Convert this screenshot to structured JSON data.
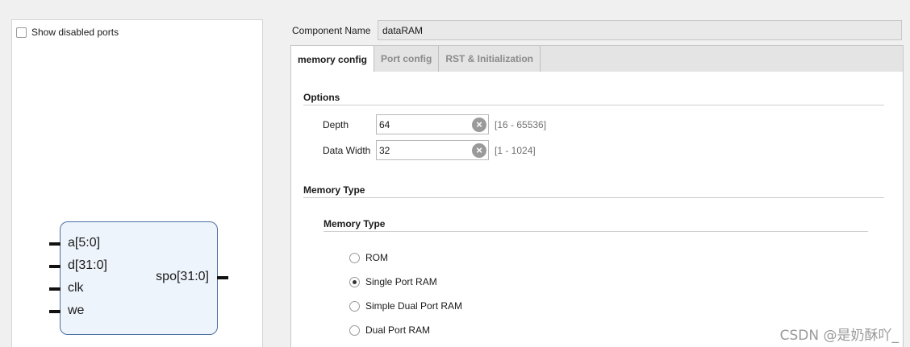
{
  "left_panel": {
    "show_disabled_label": "Show disabled ports",
    "symbol": {
      "inputs": [
        "a[5:0]",
        "d[31:0]",
        "clk",
        "we"
      ],
      "output": "spo[31:0]"
    }
  },
  "component": {
    "label": "Component Name",
    "value": "dataRAM"
  },
  "tabs": [
    {
      "label": "memory config",
      "active": true
    },
    {
      "label": "Port config",
      "active": false
    },
    {
      "label": "RST & Initialization",
      "active": false
    }
  ],
  "options": {
    "title": "Options",
    "depth_label": "Depth",
    "depth_value": "64",
    "depth_range": "[16 - 65536]",
    "width_label": "Data Width",
    "width_value": "32",
    "width_range": "[1 - 1024]"
  },
  "memory_type": {
    "section_title": "Memory Type",
    "group_title": "Memory Type",
    "options": [
      {
        "label": "ROM",
        "checked": false
      },
      {
        "label": "Single Port RAM",
        "checked": true
      },
      {
        "label": "Simple Dual Port RAM",
        "checked": false
      },
      {
        "label": "Dual Port RAM",
        "checked": false
      }
    ]
  },
  "watermark": "CSDN @是奶酥吖_",
  "icons": {
    "clear": "clear-icon"
  }
}
